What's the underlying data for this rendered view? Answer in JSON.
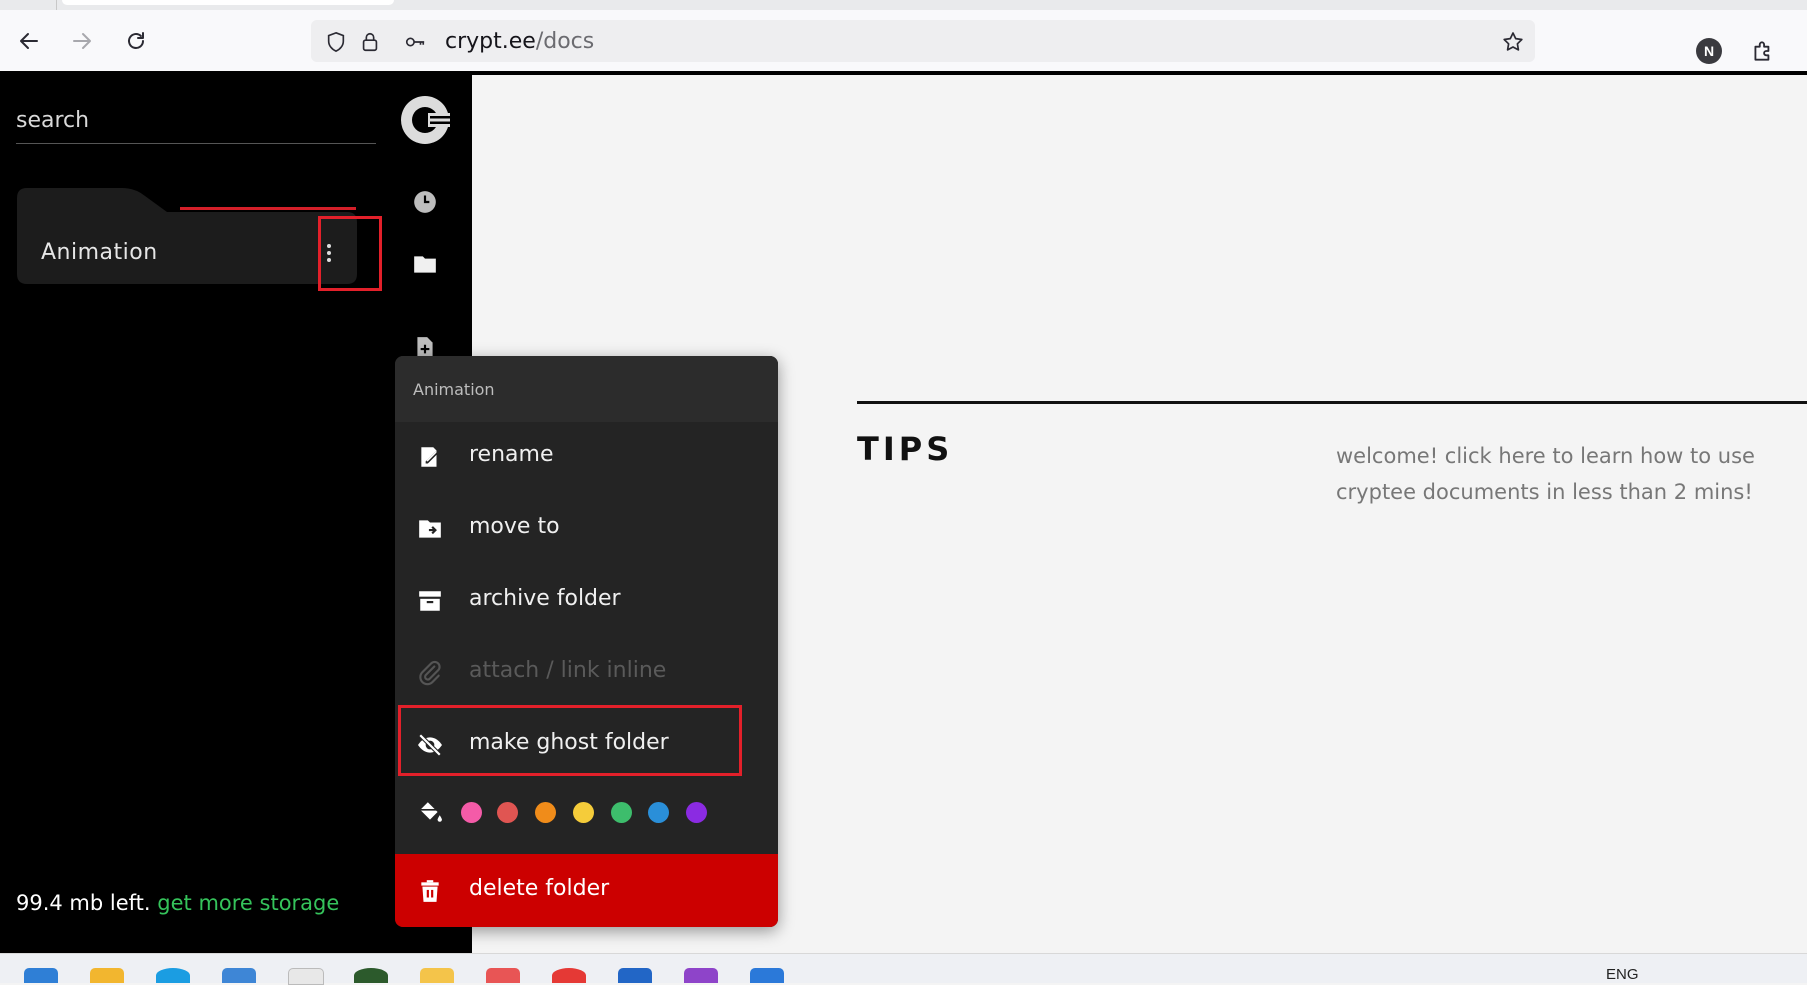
{
  "browser": {
    "url_domain": "crypt.ee",
    "url_path": "/docs",
    "profile_initial": "N"
  },
  "sidebar": {
    "search_placeholder": "search",
    "folder_label": "Animation",
    "storage_text": "99.4 mb left.",
    "storage_link": "get more storage"
  },
  "main": {
    "tips_title": "TIPS",
    "tips_text": "welcome! click here to learn how to use cryptee documents in less than 2 mins!"
  },
  "context_menu": {
    "header": "Animation",
    "items": [
      {
        "label": "rename",
        "icon": "rename-icon"
      },
      {
        "label": "move to",
        "icon": "move-folder-icon"
      },
      {
        "label": "archive folder",
        "icon": "archive-icon"
      },
      {
        "label": "attach / link inline",
        "icon": "paperclip-icon",
        "disabled": true
      },
      {
        "label": "make ghost folder",
        "icon": "ghost-eye-off-icon"
      }
    ],
    "colors": [
      "#f45ba8",
      "#e05552",
      "#f08c1a",
      "#f5cc3a",
      "#3dbd6c",
      "#2a8fd9",
      "#8b2be2"
    ],
    "delete_label": "delete folder"
  },
  "taskbar": {
    "language": "ENG"
  }
}
